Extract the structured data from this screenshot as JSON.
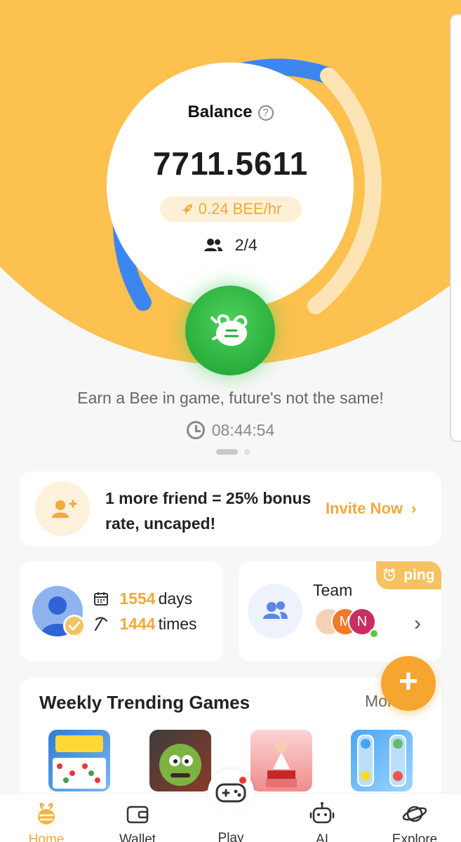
{
  "balance": {
    "title": "Balance",
    "help_icon": "question-circle-icon",
    "value": "7711.5611",
    "mining_rate": "0.24 BEE/hr",
    "members": "2/4",
    "progress_fraction": 0.55
  },
  "mine_button": {
    "icon": "bee-icon"
  },
  "slogan": "Earn a Bee in game, future's not the same!",
  "timer": "08:44:54",
  "invite": {
    "text": "1 more friend = 25% bonus rate, uncaped!",
    "link_label": "Invite Now"
  },
  "stats": {
    "days_value": "1554",
    "days_label": "days",
    "times_value": "1444",
    "times_label": "times"
  },
  "team": {
    "label": "Team",
    "ping_label": "ping",
    "avatars": [
      "",
      "M",
      "N"
    ]
  },
  "games": {
    "title": "Weekly Trending Games",
    "more_label": "More",
    "tiles": [
      "game-tile-1",
      "game-tile-2",
      "game-tile-3",
      "game-tile-4"
    ]
  },
  "nav": {
    "home": "Home",
    "wallet": "Wallet",
    "play": "Play",
    "ai": "AI",
    "explore": "Explore"
  },
  "colors": {
    "brand_yellow": "#fcc14f",
    "accent_orange": "#f2a93b",
    "ring_blue": "#3d86ef",
    "mine_green": "#22ad37"
  }
}
